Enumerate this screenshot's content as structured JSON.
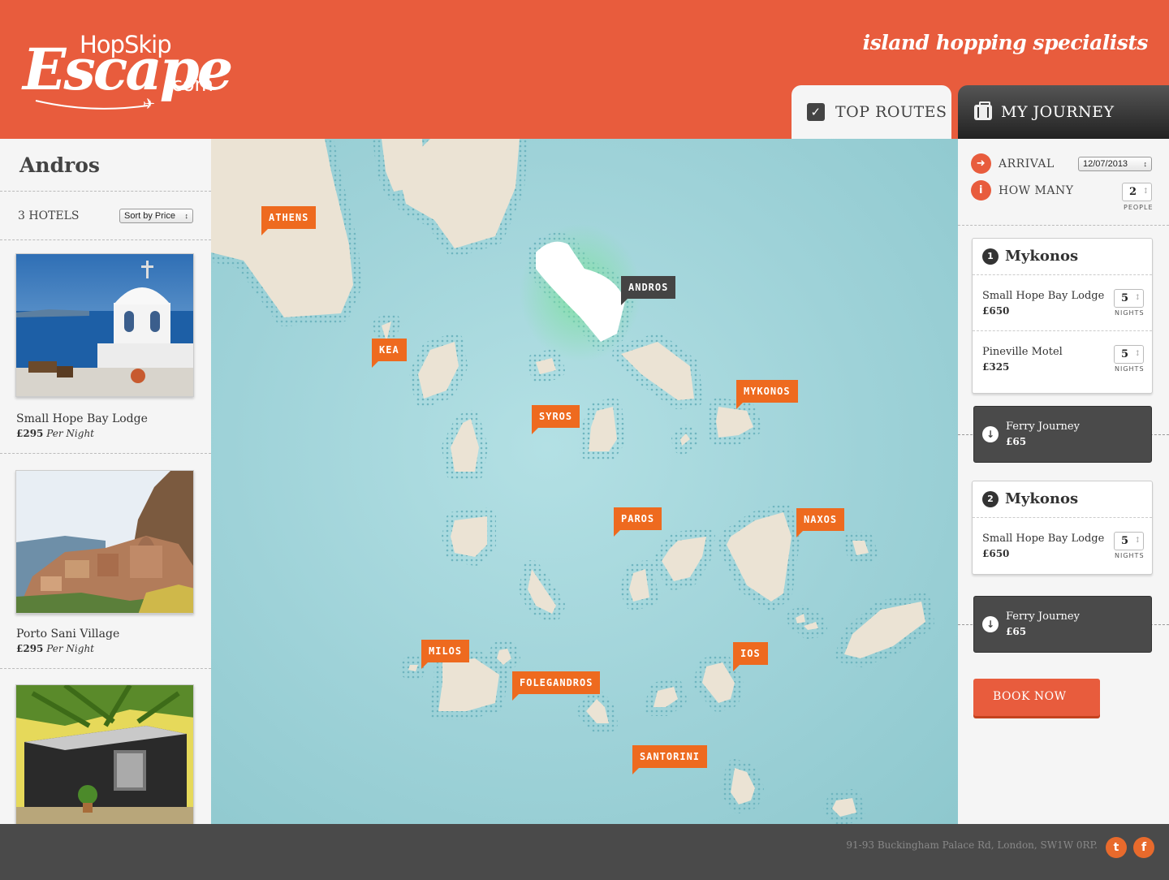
{
  "brand": {
    "logo_top": "HopSkip",
    "logo_main": "Escape",
    "logo_tld": ".com",
    "tagline": "island hopping specialists",
    "accent_color": "#e85c3d"
  },
  "tabs": {
    "routes": "TOP ROUTES",
    "journey": "MY JOURNEY"
  },
  "left": {
    "title": "Andros",
    "count": "3 HOTELS",
    "sort_value": "Sort by Price",
    "hotels": [
      {
        "name": "Small Hope Bay Lodge",
        "price": "£295",
        "unit": "Per Night"
      },
      {
        "name": "Porto Sani Village",
        "price": "£295",
        "unit": "Per Night"
      },
      {
        "name": "",
        "price": "",
        "unit": ""
      }
    ]
  },
  "map": {
    "pins": {
      "athens": "ATHENS",
      "kea": "KEA",
      "andros": "ANDROS",
      "syros": "SYROS",
      "mykonos": "MYKONOS",
      "paros": "PAROS",
      "naxos": "NAXOS",
      "milos": "MILOS",
      "folegandros": "FOLEGANDROS",
      "ios": "IOS",
      "santorini": "SANTORINI"
    },
    "selected": "ANDROS"
  },
  "journey": {
    "arrival_label": "ARRIVAL",
    "arrival_date": "12/07/2013",
    "how_many_label": "HOW MANY",
    "people_value": "2",
    "people_unit": "PEOPLE",
    "stops": [
      {
        "number": "1",
        "island": "Mykonos",
        "stays": [
          {
            "name": "Small Hope Bay Lodge",
            "price": "£650",
            "nights": "5",
            "nights_label": "NIGHTS"
          },
          {
            "name": "Pineville Motel",
            "price": "£325",
            "nights": "5",
            "nights_label": "NIGHTS"
          }
        ]
      },
      {
        "number": "2",
        "island": "Mykonos",
        "stays": [
          {
            "name": "Small Hope Bay Lodge",
            "price": "£650",
            "nights": "5",
            "nights_label": "NIGHTS"
          }
        ]
      }
    ],
    "ferries": [
      {
        "label": "Ferry Journey",
        "price": "£65"
      },
      {
        "label": "Ferry Journey",
        "price": "£65"
      }
    ],
    "book_label": "BOOK NOW"
  },
  "footer": {
    "address": "91-93 Buckingham Palace Rd, London, SW1W 0RP.",
    "twitter_glyph": "t",
    "facebook_glyph": "f"
  }
}
